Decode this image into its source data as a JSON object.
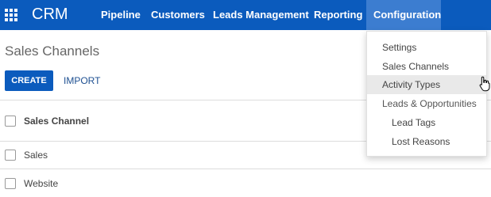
{
  "app": {
    "title": "CRM",
    "apps_icon": "grid-icon"
  },
  "nav": {
    "items": [
      {
        "label": "Pipeline"
      },
      {
        "label": "Customers"
      },
      {
        "label": "Leads Management"
      },
      {
        "label": "Reporting"
      },
      {
        "label": "Configuration"
      }
    ],
    "active": "Configuration"
  },
  "page": {
    "title": "Sales Channels"
  },
  "toolbar": {
    "create_label": "CREATE",
    "import_label": "IMPORT"
  },
  "table": {
    "header": "Sales Channel",
    "rows": [
      {
        "name": "Sales"
      },
      {
        "name": "Website"
      }
    ]
  },
  "dropdown": {
    "items": [
      {
        "label": "Settings"
      },
      {
        "label": "Sales Channels"
      },
      {
        "label": "Activity Types"
      },
      {
        "label": "Leads & Opportunities"
      },
      {
        "label": "Lead Tags"
      },
      {
        "label": "Lost Reasons"
      }
    ],
    "hovered": "Activity Types"
  },
  "cursor": "hand-pointer-icon",
  "colors": {
    "brand": "#0b5bbd",
    "nav_active": "#3c7dd0",
    "link": "#1d4f91"
  }
}
